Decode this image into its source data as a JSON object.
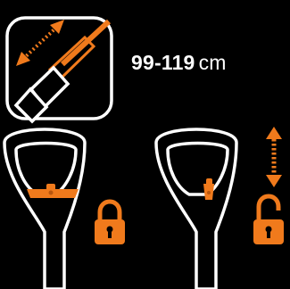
{
  "length_range": {
    "value": "99-119",
    "unit": "cm"
  },
  "icons": {
    "telescopic_badge": "telescopic-pole-icon",
    "locked_grip": "handle-locked-icon",
    "unlocked_grip": "handle-unlocked-icon",
    "padlock_closed": "padlock-locked-icon",
    "padlock_open": "padlock-unlocked-icon",
    "adjust_arrow": "vertical-adjust-arrow-icon"
  },
  "colors": {
    "accent": "#f07a1c",
    "outline": "#ffffff",
    "background": "#000000"
  }
}
